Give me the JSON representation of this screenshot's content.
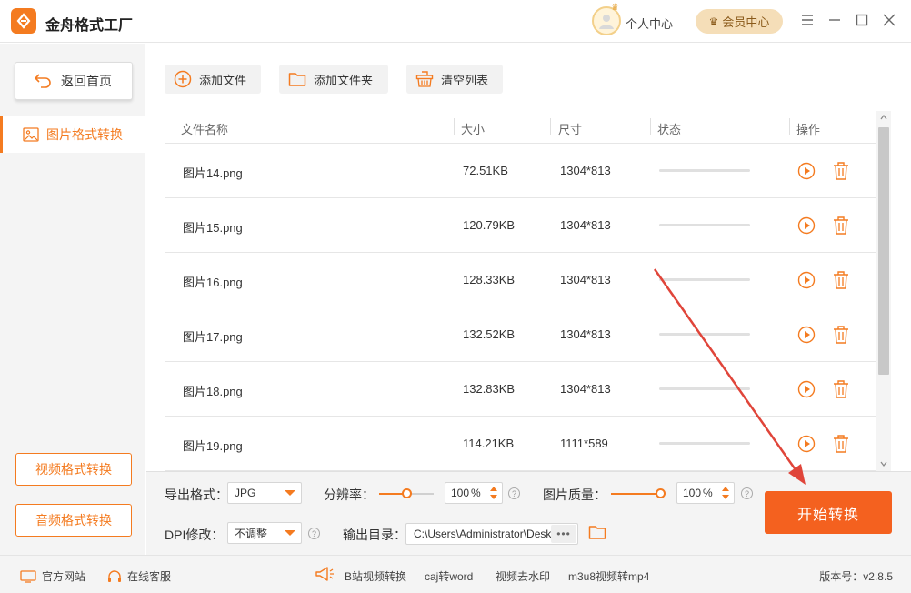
{
  "app": {
    "title": "金舟格式工厂"
  },
  "header": {
    "personal_center": "个人中心",
    "vip_center": "会员中心"
  },
  "sidebar": {
    "home": "返回首页",
    "active_item": "图片格式转换",
    "video_btn": "视频格式转换",
    "audio_btn": "音频格式转换"
  },
  "toolbar": {
    "add_file": "添加文件",
    "add_folder": "添加文件夹",
    "clear_list": "清空列表"
  },
  "table": {
    "columns": [
      "文件名称",
      "大小",
      "尺寸",
      "状态",
      "操作"
    ],
    "rows": [
      {
        "name": "图片14.png",
        "size": "72.51KB",
        "dims": "1304*813",
        "progress": 0
      },
      {
        "name": "图片15.png",
        "size": "120.79KB",
        "dims": "1304*813",
        "progress": 0
      },
      {
        "name": "图片16.png",
        "size": "128.33KB",
        "dims": "1304*813",
        "progress": 0
      },
      {
        "name": "图片17.png",
        "size": "132.52KB",
        "dims": "1304*813",
        "progress": 0
      },
      {
        "name": "图片18.png",
        "size": "132.83KB",
        "dims": "1304*813",
        "progress": 0
      },
      {
        "name": "图片19.png",
        "size": "114.21KB",
        "dims": "1111*589",
        "progress": 0
      }
    ]
  },
  "settings": {
    "export_format_label": "导出格式：",
    "export_format_value": "JPG",
    "resolution_label": "分辨率：",
    "resolution_value": "100",
    "resolution_unit": "%",
    "quality_label": "图片质量：",
    "quality_value": "100",
    "quality_unit": "%",
    "dpi_label": "DPI修改：",
    "dpi_value": "不调整",
    "output_dir_label": "输出目录：",
    "output_dir_value": "C:\\Users\\Administrator\\Desktop",
    "browse_label": "•••",
    "start_button": "开始转换"
  },
  "statusbar": {
    "official_site": "官方网站",
    "online_service": "在线客服",
    "links": [
      "B站视频转换",
      "caj转word",
      "视频去水印",
      "m3u8视频转mp4"
    ],
    "version": "版本号：v2.8.5"
  },
  "colors": {
    "accent": "#f47b20",
    "start_button": "#f4611f",
    "annotation_arrow": "#e0453a"
  }
}
